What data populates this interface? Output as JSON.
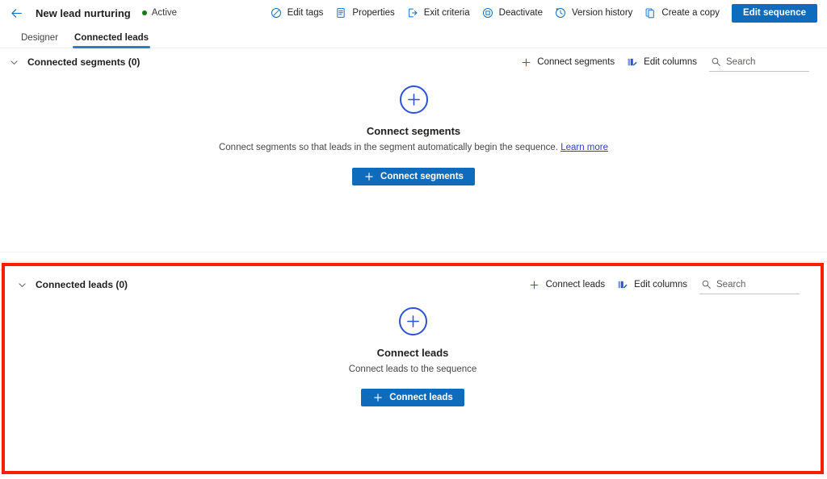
{
  "window": {
    "title": "New lead nurturing"
  },
  "header": {
    "back_icon": "arrow-left-icon",
    "title": "New lead nurturing",
    "status": {
      "label": "Active",
      "dot_color": "#107c10"
    },
    "actions": [
      {
        "label": "Edit tags",
        "icon": "tag-icon"
      },
      {
        "label": "Properties",
        "icon": "document-properties-icon"
      },
      {
        "label": "Exit criteria",
        "icon": "exit-icon"
      },
      {
        "label": "Deactivate",
        "icon": "stop-circle-icon"
      },
      {
        "label": "Version history",
        "icon": "history-icon"
      },
      {
        "label": "Create a copy",
        "icon": "copy-icon"
      }
    ],
    "primary_action": {
      "label": "Edit sequence",
      "color": "#0f6cbd"
    }
  },
  "tabs": [
    {
      "label": "Designer",
      "active": false
    },
    {
      "label": "Connected leads",
      "active": true
    }
  ],
  "segments_section": {
    "title": "Connected segments (0)",
    "chevron_icon": "chevron-down-icon",
    "tools": [
      {
        "label": "Connect segments",
        "icon": "plus-icon"
      },
      {
        "label": "Edit columns",
        "icon": "edit-columns-icon"
      }
    ],
    "search": {
      "placeholder": "Search",
      "value": "",
      "icon": "search-icon"
    },
    "empty_state": {
      "icon": "plus-circle-icon",
      "title": "Connect segments",
      "description": "Connect segments so that leads in the segment automatically begin the sequence.",
      "link_label": "Learn more",
      "button_label": "Connect segments",
      "button_icon": "plus-icon"
    }
  },
  "leads_section": {
    "title": "Connected leads (0)",
    "chevron_icon": "chevron-down-icon",
    "tools": [
      {
        "label": "Connect leads",
        "icon": "plus-icon"
      },
      {
        "label": "Edit columns",
        "icon": "edit-columns-icon"
      }
    ],
    "search": {
      "placeholder": "Search",
      "value": "",
      "icon": "search-icon"
    },
    "empty_state": {
      "icon": "plus-circle-icon",
      "title": "Connect leads",
      "description": "Connect leads to the sequence",
      "button_label": "Connect leads",
      "button_icon": "plus-icon"
    },
    "highlight_color": "#fa1e00"
  }
}
